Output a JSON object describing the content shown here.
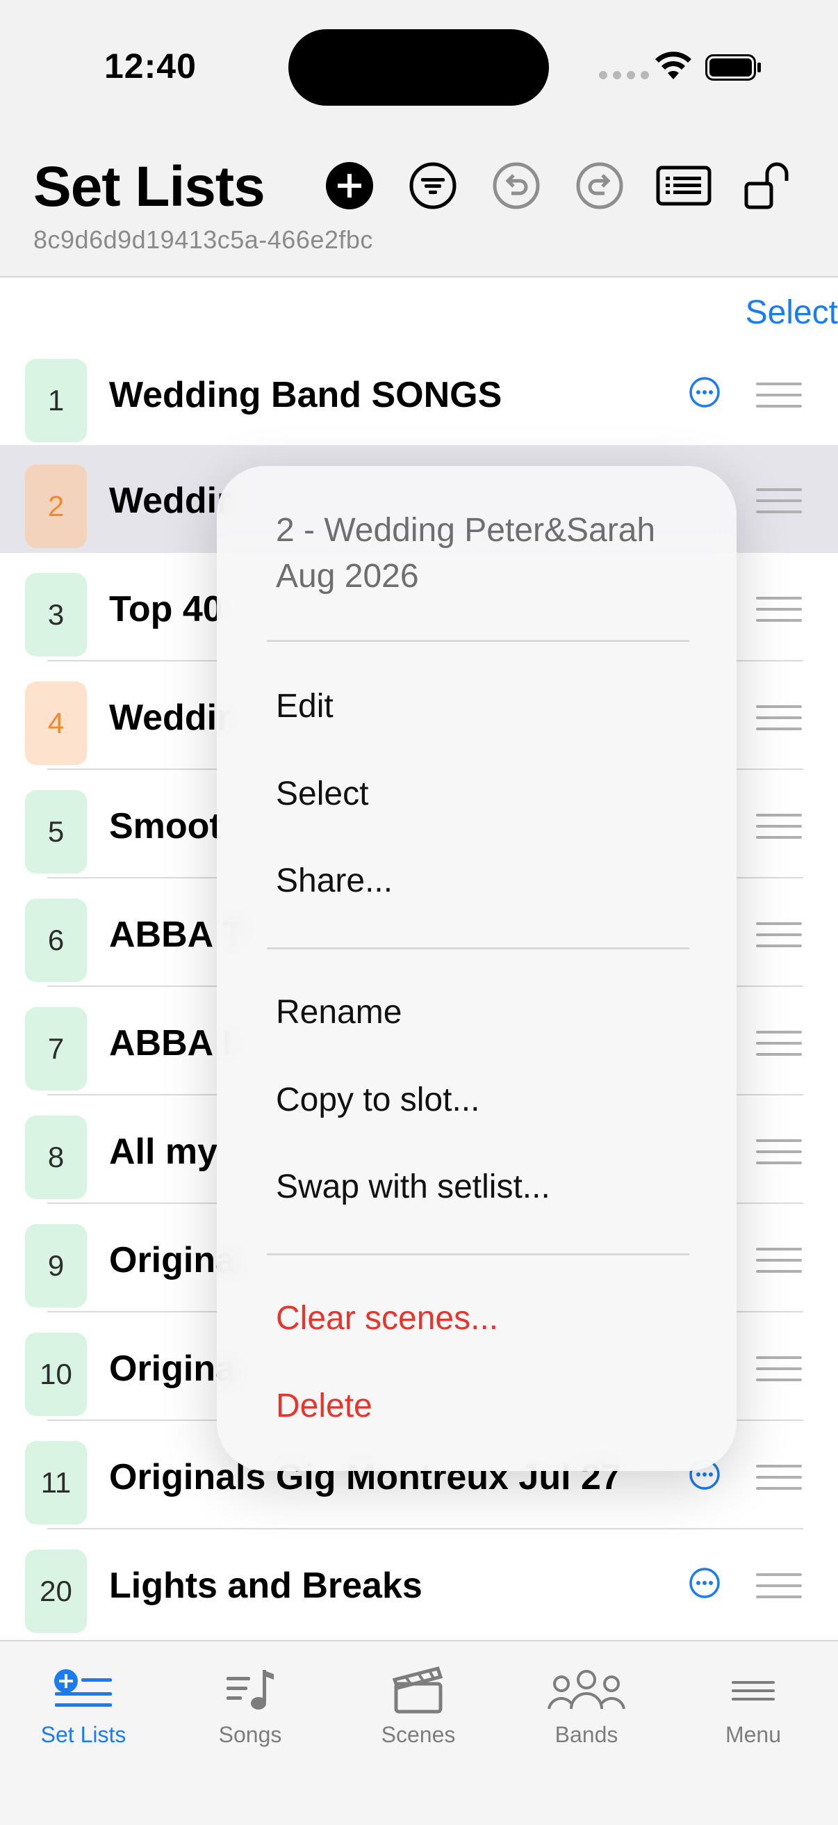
{
  "status_bar": {
    "time": "12:40"
  },
  "header": {
    "title": "Set Lists",
    "device_id": "8c9d6d9d19413c5a-466e2fbc"
  },
  "select_label": "Select",
  "setlists": [
    {
      "number": "1",
      "title": "Wedding Band SONGS",
      "badge": "green"
    },
    {
      "number": "2",
      "title": "Weddir",
      "badge": "orange",
      "highlighted": true
    },
    {
      "number": "3",
      "title": "Top 40",
      "badge": "green"
    },
    {
      "number": "4",
      "title": "Weddir",
      "badge": "orange"
    },
    {
      "number": "5",
      "title": "Smoot",
      "badge": "green"
    },
    {
      "number": "6",
      "title": "ABBA T",
      "badge": "green"
    },
    {
      "number": "7",
      "title": "ABBA I",
      "badge": "green"
    },
    {
      "number": "8",
      "title": "All my",
      "badge": "green"
    },
    {
      "number": "9",
      "title": "Origina",
      "badge": "green"
    },
    {
      "number": "10",
      "title": "Origina",
      "badge": "green"
    },
    {
      "number": "11",
      "title": "Originals Gig Montreux Jul 27",
      "badge": "green"
    },
    {
      "number": "20",
      "title": "Lights and Breaks",
      "badge": "green"
    }
  ],
  "context_menu": {
    "header": "2 - Wedding Peter&Sarah Aug 2026",
    "items": {
      "edit": "Edit",
      "select": "Select",
      "share": "Share...",
      "rename": "Rename",
      "copy_to_slot": "Copy to slot...",
      "swap": "Swap with setlist...",
      "clear_scenes": "Clear scenes...",
      "delete": "Delete"
    },
    "destructive_color": "#e8352c"
  },
  "tabbar": {
    "tabs": [
      {
        "label": "Set Lists",
        "icon": "setlist-add-icon",
        "active": true
      },
      {
        "label": "Songs",
        "icon": "music-note-list-icon"
      },
      {
        "label": "Scenes",
        "icon": "clapperboard-icon"
      },
      {
        "label": "Bands",
        "icon": "people-icon"
      },
      {
        "label": "Menu",
        "icon": "hamburger-icon"
      }
    ]
  },
  "colors": {
    "accent": "#1a7cf0",
    "badge_green": "#d9f4e2",
    "badge_orange": "#fde3cd"
  }
}
